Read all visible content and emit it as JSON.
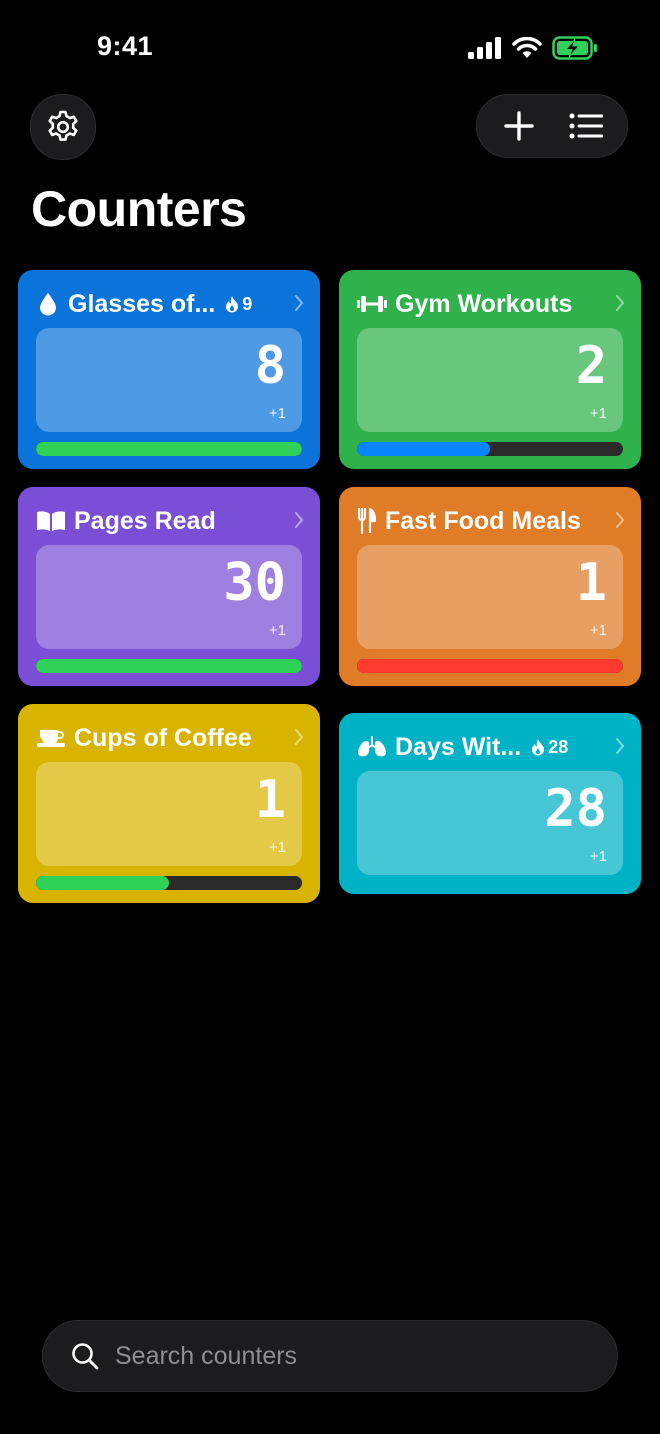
{
  "status_bar": {
    "time": "9:41"
  },
  "header": {
    "title": "Counters"
  },
  "search": {
    "placeholder": "Search counters"
  },
  "colors": {
    "bar_green": "#2ecc55",
    "bar_red": "#ff3b3b",
    "bar_blue": "#0a84ff"
  },
  "counters": [
    {
      "title": "Glasses of...",
      "icon": "water-drop-icon",
      "streak": "9",
      "count": "8",
      "increment": "+1",
      "progress": 1.0,
      "progress_color": "#30d158",
      "bg": "#0a74da"
    },
    {
      "title": "Gym Workouts",
      "icon": "dumbbell-icon",
      "count": "2",
      "increment": "+1",
      "progress": 0.5,
      "progress_color": "#0a84ff",
      "bg": "#2fb24b"
    },
    {
      "title": "Pages Read",
      "icon": "book-icon",
      "count": "30",
      "increment": "+1",
      "progress": 1.0,
      "progress_color": "#30d158",
      "bg": "#7a4fd6"
    },
    {
      "title": "Fast Food Meals",
      "icon": "fork-knife-icon",
      "count": "1",
      "increment": "+1",
      "progress": 1.0,
      "progress_color": "#ff3b30",
      "bg": "#e07b28"
    },
    {
      "title": "Cups of Coffee",
      "icon": "coffee-cup-icon",
      "count": "1",
      "increment": "+1",
      "progress": 0.5,
      "progress_color": "#30d158",
      "bg": "#d8b400"
    },
    {
      "title": "Days Wit...",
      "icon": "lungs-icon",
      "streak": "28",
      "count": "28",
      "increment": "+1",
      "bg": "#00b2c5"
    }
  ]
}
